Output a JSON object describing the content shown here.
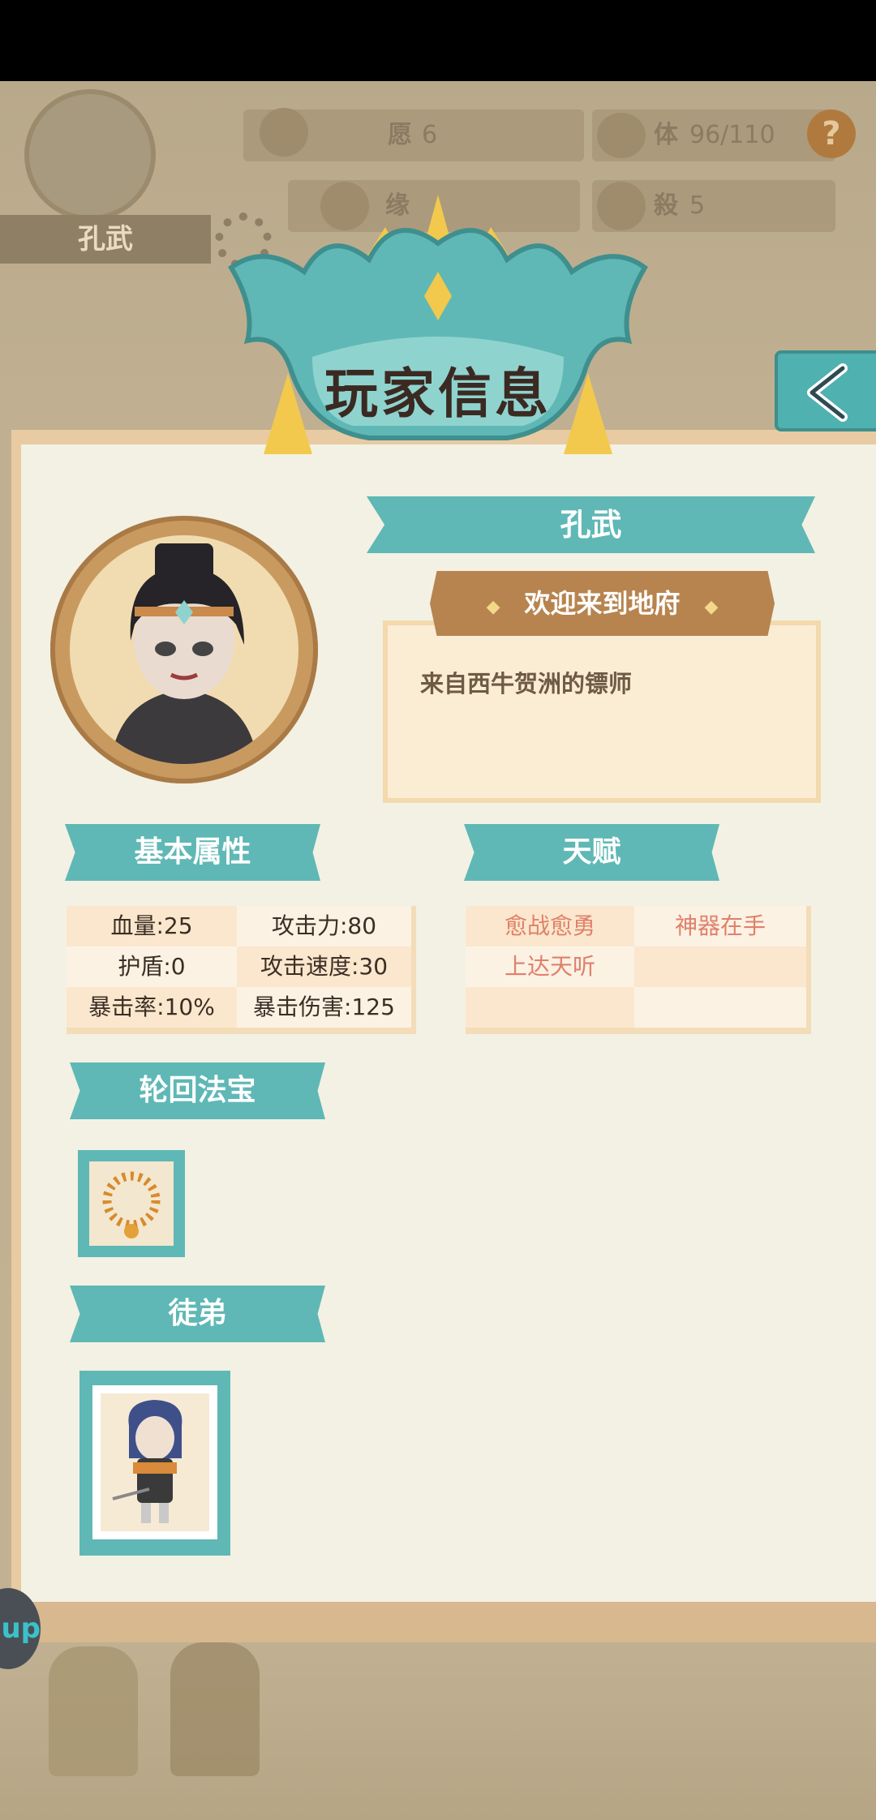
{
  "hud": {
    "player_name": "孔武",
    "wish_label": "愿",
    "wish_value": "6",
    "stamina_label": "体",
    "stamina_value": "96/110",
    "fate_label": "缘",
    "kill_label": "殺",
    "kill_value": "5",
    "help_symbol": "?"
  },
  "dialog": {
    "title": "玩家信息",
    "player_name": "孔武",
    "welcome": "欢迎来到地府",
    "bio": "来自西牛贺洲的镖师",
    "talent_bullet": "◆"
  },
  "sections": {
    "basic_attributes": "基本属性",
    "talents": "天赋",
    "treasure": "轮回法宝",
    "disciple": "徒弟"
  },
  "attributes": [
    [
      "血量:25",
      "攻击力:80"
    ],
    [
      "护盾:0",
      "攻击速度:30"
    ],
    [
      "暴击率:10%",
      "暴击伤害:125"
    ]
  ],
  "talents": [
    [
      "愈战愈勇",
      "神器在手"
    ],
    [
      "上达天听",
      ""
    ],
    [
      "",
      ""
    ]
  ],
  "floating_button": "up",
  "colors": {
    "teal": "#5fb8b5",
    "panel": "#f3f1e4",
    "talent_text": "#e0806a",
    "title_text": "#3b2a22"
  }
}
